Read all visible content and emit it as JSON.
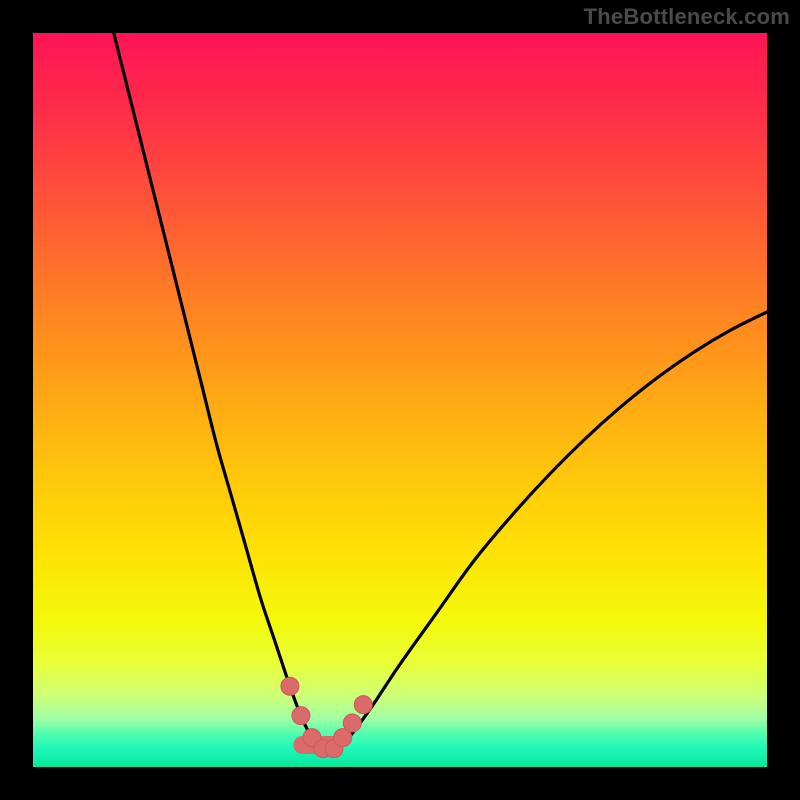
{
  "watermark": "TheBottleneck.com",
  "colors": {
    "background": "#000000",
    "gradient_stops": [
      {
        "offset": 0.0,
        "color": "#ff1455"
      },
      {
        "offset": 0.1,
        "color": "#ff2b4a"
      },
      {
        "offset": 0.25,
        "color": "#ff5a35"
      },
      {
        "offset": 0.4,
        "color": "#ff8a1f"
      },
      {
        "offset": 0.55,
        "color": "#ffb80f"
      },
      {
        "offset": 0.7,
        "color": "#ffe005"
      },
      {
        "offset": 0.8,
        "color": "#f4f80a"
      },
      {
        "offset": 0.86,
        "color": "#e8ff3a"
      },
      {
        "offset": 0.905,
        "color": "#ccff7a"
      },
      {
        "offset": 0.935,
        "color": "#9effa5"
      },
      {
        "offset": 0.955,
        "color": "#50fcb0"
      },
      {
        "offset": 0.975,
        "color": "#1ff8b8"
      },
      {
        "offset": 1.0,
        "color": "#06e79c"
      }
    ],
    "curve": "#000000",
    "marker_fill": "#db6b6b",
    "marker_stroke": "#c95a5a"
  },
  "chart_data": {
    "type": "line",
    "title": "",
    "xlabel": "",
    "ylabel": "",
    "xlim": [
      0,
      100
    ],
    "ylim": [
      0,
      100
    ],
    "grid": false,
    "series": [
      {
        "name": "bottleneck-curve",
        "x": [
          11,
          13,
          15,
          17,
          19,
          21,
          23,
          25,
          27,
          29,
          31,
          33,
          35,
          36.5,
          38,
          39.5,
          41,
          43,
          46,
          50,
          55,
          60,
          65,
          70,
          75,
          80,
          85,
          90,
          95,
          100
        ],
        "y": [
          100,
          92,
          84,
          76,
          68,
          60,
          52,
          44,
          37,
          30,
          23,
          17,
          11,
          7,
          4,
          2.5,
          2.5,
          4,
          8,
          14,
          21,
          28,
          34,
          39.5,
          44.5,
          49,
          53,
          56.5,
          59.5,
          62
        ]
      }
    ],
    "markers": {
      "name": "highlight-dots",
      "x": [
        35.0,
        36.5,
        38.0,
        39.5,
        41.0,
        42.2,
        43.5,
        45.0
      ],
      "y": [
        11.0,
        7.0,
        4.0,
        2.5,
        2.5,
        4.0,
        6.0,
        8.5
      ],
      "r": 9
    },
    "bottom_segment": {
      "x": [
        36.7,
        41.0
      ],
      "y": [
        3.0,
        3.0
      ]
    }
  }
}
